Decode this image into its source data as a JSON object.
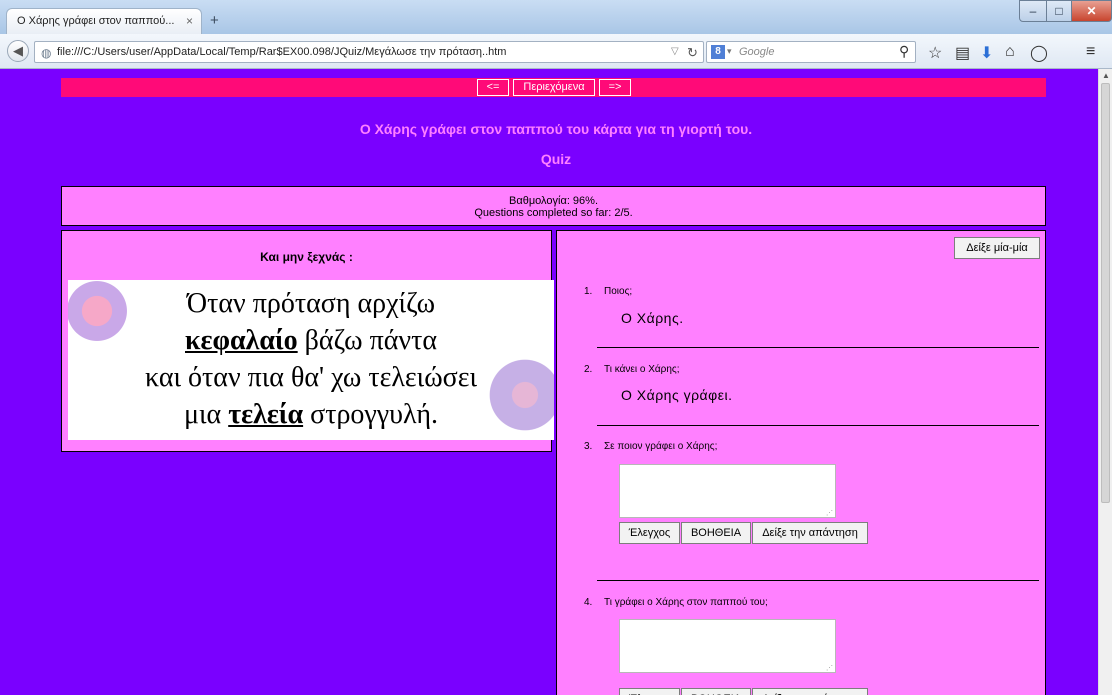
{
  "browser": {
    "tab_title": "Ο Χάρης γράφει στον παππού...",
    "tab_close": "×",
    "new_tab": "+",
    "url": "file:///C:/Users/user/AppData/Local/Temp/Rar$EX00.098/JQuiz/Μεγάλωσε την πρόταση..htm",
    "search_placeholder": "Google"
  },
  "page": {
    "nav": {
      "prev": "<=",
      "contents": "Περιεχόμενα",
      "next": "=>"
    },
    "title": "Ο Χάρης γράφει στον παππού του κάρτα για τη γιορτή του.",
    "subtitle": "Quiz",
    "score": {
      "line1": "Βαθμολογία: 96%.",
      "line2": "Questions completed so far: 2/5."
    },
    "left": {
      "heading": "Και μην ξεχνάς :",
      "poem": {
        "line1": "Όταν πρόταση αρχίζω",
        "line2_bold": "κεφαλαίο",
        "line2_rest": " βάζω πάντα",
        "line3": "και όταν πια θα' χω τελειώσει",
        "line4_pre": "μια ",
        "line4_bold": "τελεία",
        "line4_post": " στρογγυλή."
      }
    },
    "right": {
      "show_one_button": "Δείξε μία-μία",
      "questions": [
        {
          "num": "1.",
          "text": "Ποιος;",
          "answer": "Ο Χάρης."
        },
        {
          "num": "2.",
          "text": "Τι κάνει ο Χάρης;",
          "answer": "Ο Χάρης γράφει."
        },
        {
          "num": "3.",
          "text": "Σε ποιον γράφει ο Χάρης;"
        },
        {
          "num": "4.",
          "text": "Τι γράφει ο Χάρης στον παππού του;"
        }
      ],
      "buttons": {
        "check": "Έλεγχος",
        "help": "ΒΟΗΘΕΙΑ",
        "show_answer": "Δείξε την απάντηση"
      }
    }
  },
  "colors": {
    "page_bg": "#7a00ff",
    "panel_bg": "#ff80ff",
    "nav_strip": "#ff0a78",
    "title_text": "#ff80ff"
  }
}
